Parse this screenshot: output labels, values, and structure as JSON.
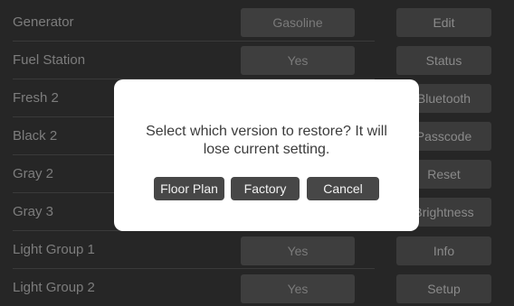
{
  "settings": {
    "rows": [
      {
        "label": "Generator",
        "value": "Gasoline",
        "action": "Edit"
      },
      {
        "label": "Fuel Station",
        "value": "Yes",
        "action": "Status"
      },
      {
        "label": "Fresh 2",
        "value": "",
        "action": "Bluetooth"
      },
      {
        "label": "Black 2",
        "value": "",
        "action": "Passcode"
      },
      {
        "label": "Gray 2",
        "value": "",
        "action": "Reset"
      },
      {
        "label": "Gray 3",
        "value": "",
        "action": "Brightness"
      },
      {
        "label": "Light Group 1",
        "value": "Yes",
        "action": "Info"
      },
      {
        "label": "Light Group 2",
        "value": "Yes",
        "action": "Setup"
      }
    ]
  },
  "dialog": {
    "message_line1": "Select which version to restore? It will",
    "message_line2": "lose current setting.",
    "buttons": {
      "floor_plan": "Floor Plan",
      "factory": "Factory",
      "cancel": "Cancel"
    }
  },
  "colors": {
    "background": "#262626",
    "dialog_background": "#ffffff",
    "dialog_button": "#474747"
  }
}
